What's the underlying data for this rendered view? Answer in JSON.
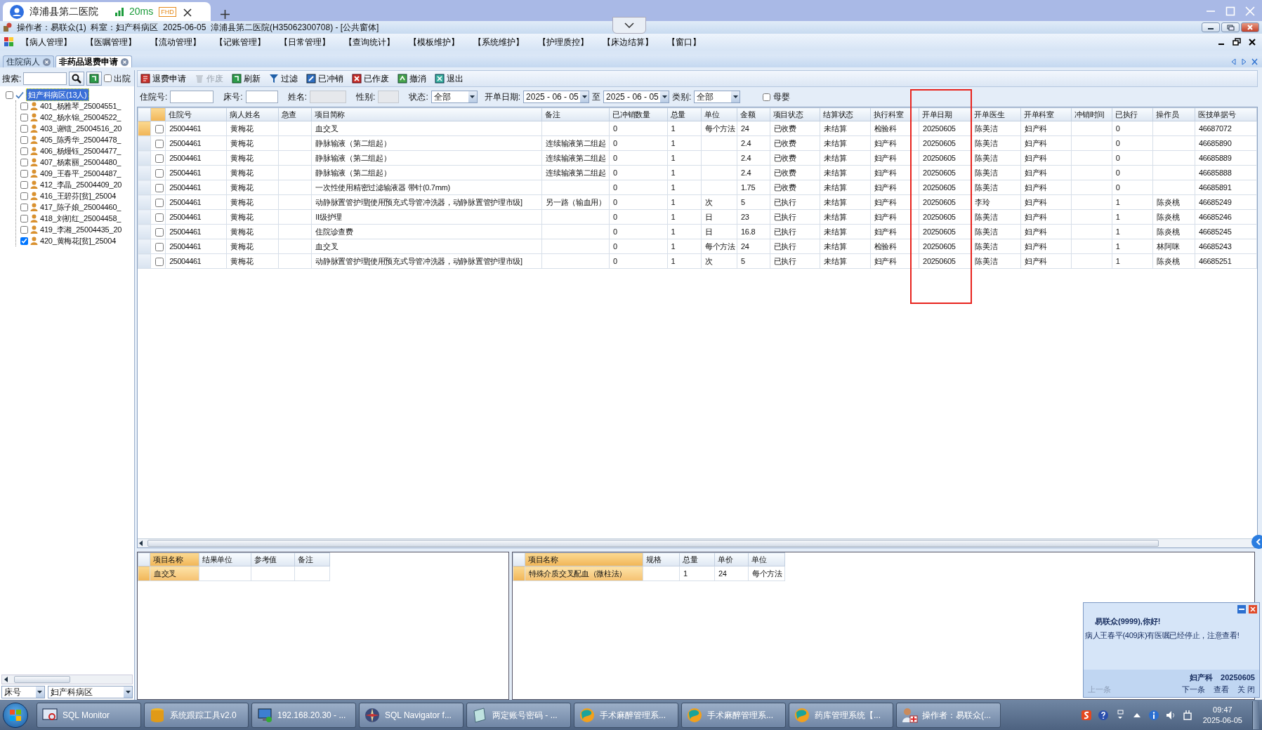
{
  "browser": {
    "tab_title": "漳浦县第二医院",
    "latency": "20ms",
    "quality_badge": "FHD"
  },
  "app": {
    "title": "操作者：易联众(1)  科室：妇产科病区  2025-06-05  漳浦县第二医院(H35062300708) - [公共窗体]"
  },
  "menu": [
    "【病人管理】",
    "【医嘱管理】",
    "【流动管理】",
    "【记账管理】",
    "【日常管理】",
    "【查询统计】",
    "【模板维护】",
    "【系统维护】",
    "【护理质控】",
    "【床边结算】",
    "【窗口】"
  ],
  "doc_tabs": [
    {
      "label": "住院病人",
      "selected": false
    },
    {
      "label": "非药品退费申请",
      "selected": true
    }
  ],
  "sidebar": {
    "search_label": "搜索:",
    "discharged_label": "出院",
    "discharged_checked": false,
    "tree": {
      "label": "妇产科病区(13人)",
      "selected": true,
      "checked": false,
      "children": [
        {
          "label": "401_杨雅琴_25004551_",
          "checked": false
        },
        {
          "label": "402_杨水锦_25004522_",
          "checked": false
        },
        {
          "label": "403_谢镭_25004516_20",
          "checked": false
        },
        {
          "label": "405_陈秀华_25004478_",
          "checked": false
        },
        {
          "label": "406_杨熳钰_25004477_",
          "checked": false
        },
        {
          "label": "407_杨素丽_25004480_",
          "checked": false
        },
        {
          "label": "409_王春平_25004487_",
          "checked": false
        },
        {
          "label": "412_李晶_25004409_20",
          "checked": false
        },
        {
          "label": "416_王碧芬[贫]_25004",
          "checked": false
        },
        {
          "label": "417_陈子娘_25004460_",
          "checked": false
        },
        {
          "label": "418_刘初红_25004458_",
          "checked": false
        },
        {
          "label": "419_李湘_25004435_20",
          "checked": false
        },
        {
          "label": "420_黄梅花[贫]_25004",
          "checked": true
        }
      ]
    },
    "sort_field": "床号",
    "ward_field": "妇产科病区"
  },
  "toolbar": [
    {
      "label": "退费申请",
      "disabled": false
    },
    {
      "label": "作废",
      "disabled": true
    },
    {
      "label": "刷新",
      "disabled": false
    },
    {
      "label": "过滤",
      "disabled": false
    },
    {
      "label": "已冲销",
      "disabled": false
    },
    {
      "label": "已作废",
      "disabled": false
    },
    {
      "label": "撤消",
      "disabled": false
    },
    {
      "label": "退出",
      "disabled": false
    }
  ],
  "filters": [
    {
      "kind": "input",
      "label": "住院号:"
    },
    {
      "kind": "input",
      "label": "床号:"
    },
    {
      "kind": "readonly",
      "label": "姓名:"
    },
    {
      "kind": "readonly",
      "label": "性别:"
    },
    {
      "kind": "select",
      "label": "状态:",
      "value": "全部"
    },
    {
      "kind": "date",
      "label": "开单日期:",
      "value": "2025 - 06 - 05"
    },
    {
      "kind": "date",
      "label": "至",
      "value": "2025 - 06 - 05"
    },
    {
      "kind": "select",
      "label": "类别:",
      "value": "全部"
    },
    {
      "kind": "checkbox",
      "label": "母婴",
      "checked": false
    }
  ],
  "table": {
    "columns": [
      {
        "label": "住院号",
        "highlighted": false
      },
      {
        "label": "病人姓名",
        "highlighted": false
      },
      {
        "label": "急查",
        "highlighted": false
      },
      {
        "label": "项目简称",
        "highlighted": false
      },
      {
        "label": "备注",
        "highlighted": false
      },
      {
        "label": "已冲销数量",
        "highlighted": false
      },
      {
        "label": "总量",
        "highlighted": false
      },
      {
        "label": "单位",
        "highlighted": false
      },
      {
        "label": "金额",
        "highlighted": false
      },
      {
        "label": "项目状态",
        "highlighted": false
      },
      {
        "label": "结算状态",
        "highlighted": false
      },
      {
        "label": "执行科室",
        "highlighted": false
      },
      {
        "label": "开单日期",
        "highlighted": true
      },
      {
        "label": "开单医生",
        "highlighted": false
      },
      {
        "label": "开单科室",
        "highlighted": false
      },
      {
        "label": "冲销时间",
        "highlighted": false
      },
      {
        "label": "已执行",
        "highlighted": false
      },
      {
        "label": "操作员",
        "highlighted": false
      },
      {
        "label": "医技单据号",
        "highlighted": false
      }
    ],
    "rows": [
      {
        "selected": true,
        "checked": false,
        "cells": [
          "25004461",
          "黄梅花",
          "",
          "血交叉",
          "",
          "0",
          "1",
          "每个方法",
          "24",
          "已收费",
          "未结算",
          "检验科",
          "20250605",
          "陈美洁",
          "妇产科",
          "",
          "0",
          "",
          "46687072"
        ]
      },
      {
        "selected": false,
        "checked": false,
        "cells": [
          "25004461",
          "黄梅花",
          "",
          "静脉输液（第二组起）",
          "连续输液第二组起",
          "0",
          "1",
          "",
          "2.4",
          "已收费",
          "未结算",
          "妇产科",
          "20250605",
          "陈美洁",
          "妇产科",
          "",
          "0",
          "",
          "46685890"
        ]
      },
      {
        "selected": false,
        "checked": false,
        "cells": [
          "25004461",
          "黄梅花",
          "",
          "静脉输液（第二组起）",
          "连续输液第二组起",
          "0",
          "1",
          "",
          "2.4",
          "已收费",
          "未结算",
          "妇产科",
          "20250605",
          "陈美洁",
          "妇产科",
          "",
          "0",
          "",
          "46685889"
        ]
      },
      {
        "selected": false,
        "checked": false,
        "cells": [
          "25004461",
          "黄梅花",
          "",
          "静脉输液（第二组起）",
          "连续输液第二组起",
          "0",
          "1",
          "",
          "2.4",
          "已收费",
          "未结算",
          "妇产科",
          "20250605",
          "陈美洁",
          "妇产科",
          "",
          "0",
          "",
          "46685888"
        ]
      },
      {
        "selected": false,
        "checked": false,
        "cells": [
          "25004461",
          "黄梅花",
          "",
          "一次性使用精密过滤输液器 带针(0.7mm)",
          "",
          "0",
          "1",
          "",
          "1.75",
          "已收费",
          "未结算",
          "妇产科",
          "20250605",
          "陈美洁",
          "妇产科",
          "",
          "0",
          "",
          "46685891"
        ]
      },
      {
        "selected": false,
        "checked": false,
        "cells": [
          "25004461",
          "黄梅花",
          "",
          "动静脉置管护理[使用预充式导管冲洗器，动静脉置管护理市级]",
          "另一路（输血用）",
          "0",
          "1",
          "次",
          "5",
          "已执行",
          "未结算",
          "妇产科",
          "20250605",
          "李玲",
          "妇产科",
          "",
          "1",
          "陈炎桃",
          "46685249"
        ]
      },
      {
        "selected": false,
        "checked": false,
        "cells": [
          "25004461",
          "黄梅花",
          "",
          "II级护理",
          "",
          "0",
          "1",
          "日",
          "23",
          "已执行",
          "未结算",
          "妇产科",
          "20250605",
          "陈美洁",
          "妇产科",
          "",
          "1",
          "陈炎桃",
          "46685246"
        ]
      },
      {
        "selected": false,
        "checked": false,
        "cells": [
          "25004461",
          "黄梅花",
          "",
          "住院诊查费",
          "",
          "0",
          "1",
          "日",
          "16.8",
          "已执行",
          "未结算",
          "妇产科",
          "20250605",
          "陈美洁",
          "妇产科",
          "",
          "1",
          "陈炎桃",
          "46685245"
        ]
      },
      {
        "selected": false,
        "checked": false,
        "cells": [
          "25004461",
          "黄梅花",
          "",
          "血交叉",
          "",
          "0",
          "1",
          "每个方法",
          "24",
          "已执行",
          "未结算",
          "检验科",
          "20250605",
          "陈美洁",
          "妇产科",
          "",
          "1",
          "林阿咪",
          "46685243"
        ]
      },
      {
        "selected": false,
        "checked": false,
        "cells": [
          "25004461",
          "黄梅花",
          "",
          "动静脉置管护理[使用预充式导管冲洗器，动静脉置管护理市级]",
          "",
          "0",
          "1",
          "次",
          "5",
          "已执行",
          "未结算",
          "妇产科",
          "20250605",
          "陈美洁",
          "妇产科",
          "",
          "1",
          "陈炎桃",
          "46685251"
        ]
      }
    ]
  },
  "detail_left": {
    "columns": [
      "项目名称",
      "结果单位",
      "参考值",
      "备注"
    ],
    "rows": [
      {
        "selected": true,
        "cells": [
          "血交叉",
          "",
          "",
          ""
        ]
      }
    ]
  },
  "detail_right": {
    "columns": [
      "项目名称",
      "规格",
      "总量",
      "单价",
      "单位"
    ],
    "rows": [
      {
        "selected": true,
        "cells": [
          "特殊介质交叉配血（微柱法）",
          "",
          "1",
          "24",
          "每个方法"
        ]
      }
    ]
  },
  "notification": {
    "greeting": "易联众(9999),你好!",
    "message": "病人王春平(409床)有医嘱已经停止，注意查看!",
    "footer_dept": "妇产科",
    "footer_date": "20250605",
    "links": [
      {
        "label": "上一条",
        "disabled": true
      },
      {
        "label": "下一条",
        "disabled": false
      },
      {
        "label": "查看",
        "disabled": false
      },
      {
        "label": "关 闭",
        "disabled": false
      }
    ]
  },
  "taskbar": {
    "items": [
      {
        "label": "SQL Monitor"
      },
      {
        "label": "系统跟踪工具v2.0"
      },
      {
        "label": "192.168.20.30 - ..."
      },
      {
        "label": "SQL Navigator f..."
      },
      {
        "label": "两定账号密码 - ..."
      },
      {
        "label": "手术麻醉管理系..."
      },
      {
        "label": "手术麻醉管理系..."
      },
      {
        "label": "药库管理系统【..."
      },
      {
        "label": "操作者：易联众(..."
      }
    ],
    "time": "09:47",
    "date": "2025-06-05"
  }
}
